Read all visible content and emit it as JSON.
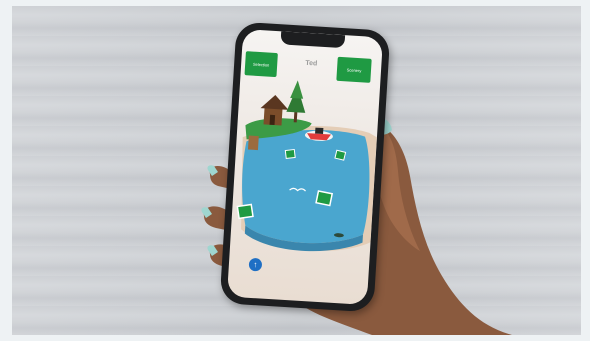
{
  "app": {
    "title": "Ted",
    "left_button_label": "Selection",
    "right_button_label": "Scenery"
  },
  "icons": {
    "fab": "arrow-up-icon",
    "markers": "map-marker-icon",
    "boat": "boat-icon",
    "cabin": "cabin-icon",
    "tree": "tree-icon"
  },
  "colors": {
    "accent": "#1f9a43",
    "water": "#4aa6cf",
    "fab": "#1f6fc4"
  }
}
